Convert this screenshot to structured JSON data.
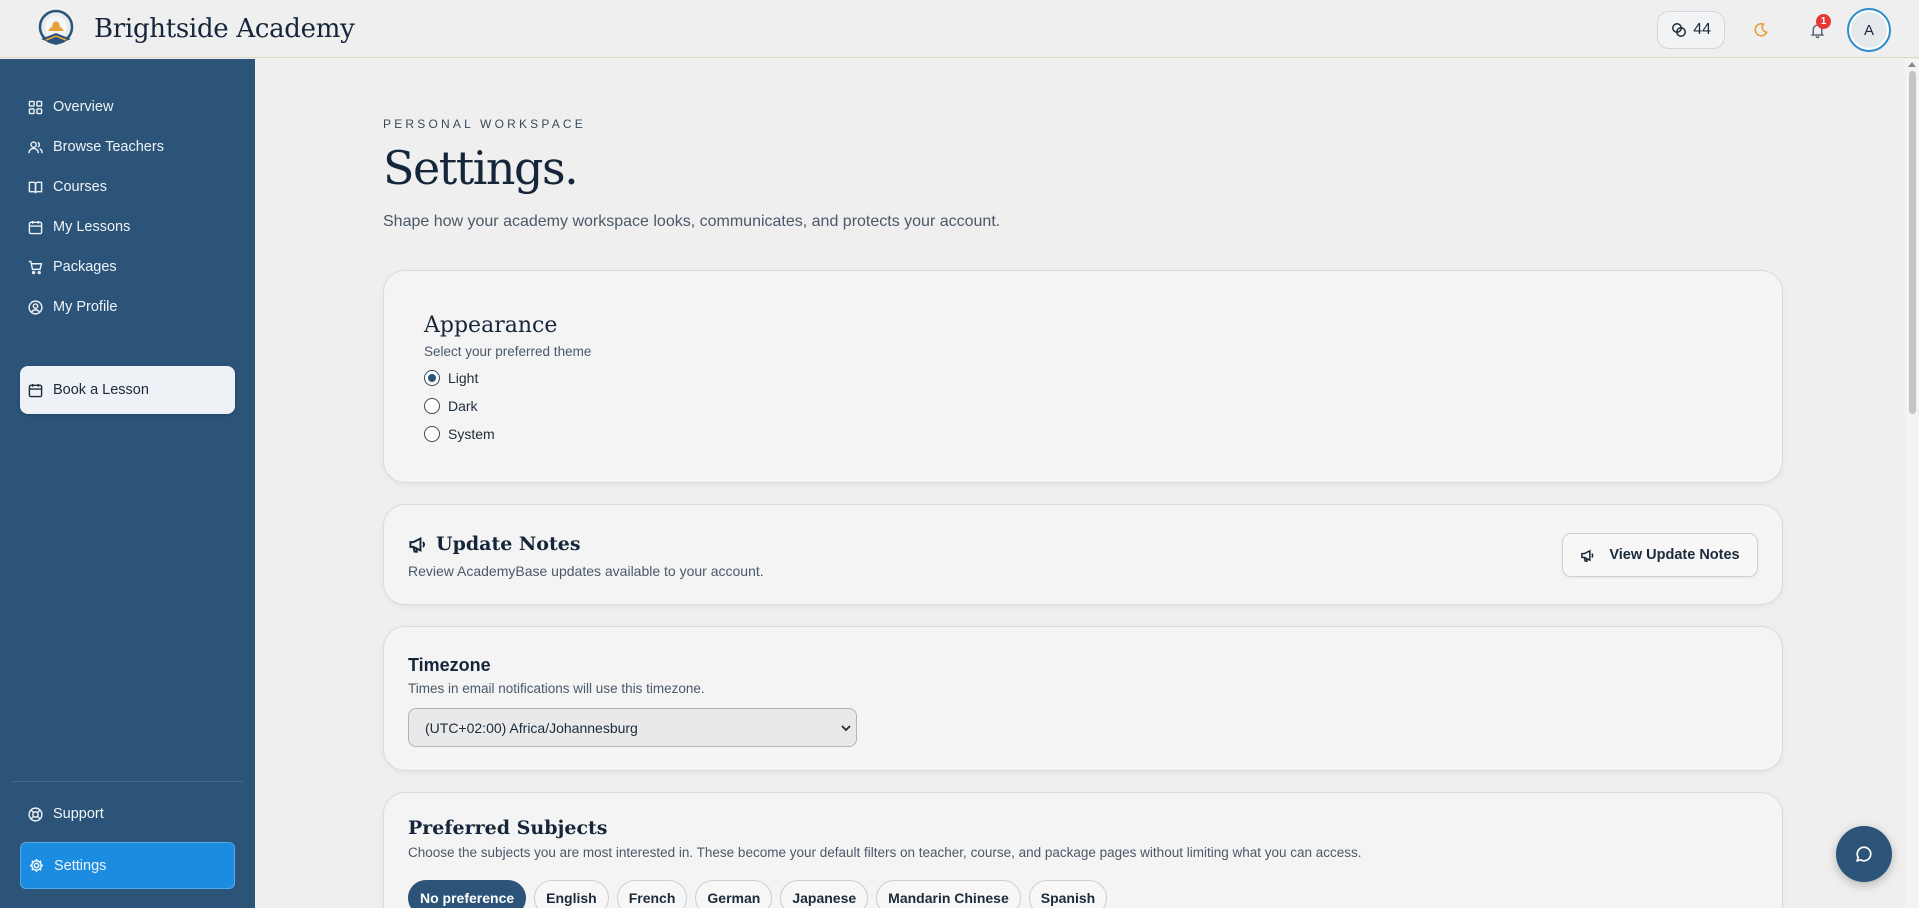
{
  "header": {
    "brand_name": "Brightside Academy",
    "credits": "44",
    "notifications_count": "1",
    "avatar_initial": "A"
  },
  "sidebar": {
    "items": [
      {
        "label": "Overview",
        "icon": "grid-icon"
      },
      {
        "label": "Browse Teachers",
        "icon": "users-icon"
      },
      {
        "label": "Courses",
        "icon": "book-open-icon"
      },
      {
        "label": "My Lessons",
        "icon": "calendar-icon"
      },
      {
        "label": "Packages",
        "icon": "cart-icon"
      },
      {
        "label": "My Profile",
        "icon": "user-circle-icon"
      }
    ],
    "book_label": "Book a Lesson",
    "support_label": "Support",
    "settings_label": "Settings"
  },
  "page": {
    "eyebrow": "PERSONAL WORKSPACE",
    "title": "Settings.",
    "description": "Shape how your academy workspace looks, communicates, and protects your account."
  },
  "appearance": {
    "title": "Appearance",
    "subtitle": "Select your preferred theme",
    "options": [
      "Light",
      "Dark",
      "System"
    ],
    "selected": "Light"
  },
  "update_notes": {
    "title": "Update Notes",
    "description": "Review AcademyBase updates available to your account.",
    "button_label": "View Update Notes"
  },
  "timezone": {
    "title": "Timezone",
    "description": "Times in email notifications will use this timezone.",
    "value": "(UTC+02:00) Africa/Johannesburg"
  },
  "subjects": {
    "title": "Preferred Subjects",
    "description": "Choose the subjects you are most interested in. These become your default filters on teacher, course, and package pages without limiting what you can access.",
    "chips": [
      "No preference",
      "English",
      "French",
      "German",
      "Japanese",
      "Mandarin Chinese",
      "Spanish"
    ],
    "selected": "No preference"
  },
  "colors": {
    "sidebar": "#2c5478",
    "active": "#1b8ce0",
    "accent": "#e8a13a"
  }
}
